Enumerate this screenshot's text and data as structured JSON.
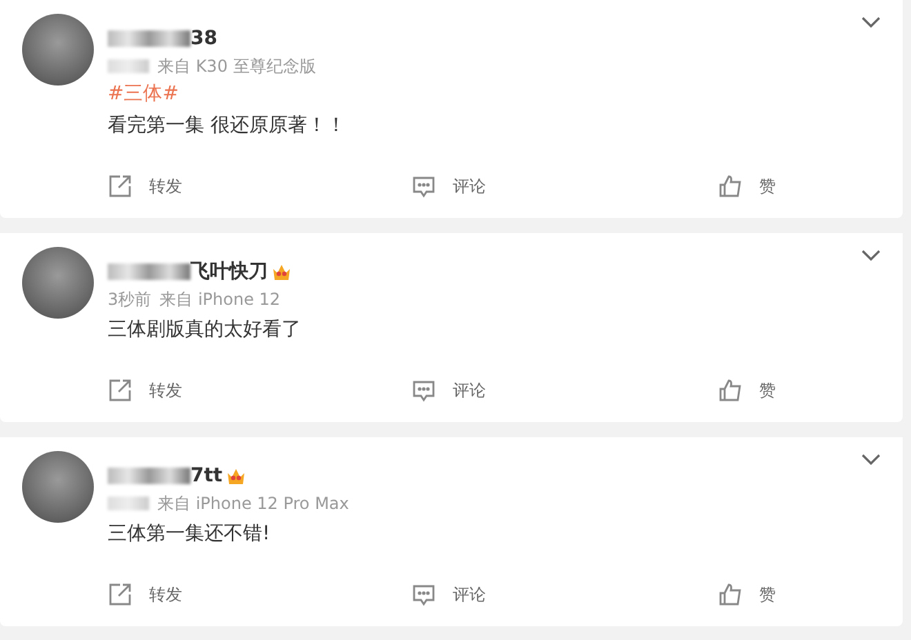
{
  "posts": [
    {
      "name": "38",
      "vip": false,
      "source": "来自 K30 至尊纪念版",
      "topic": "#三体#",
      "text": "看完第一集 很还原原著！！",
      "actions": [
        "转发",
        "评论",
        "赞"
      ]
    },
    {
      "name": "飞叶快刀",
      "vip": true,
      "time": "3秒前",
      "source": "来自 iPhone 12",
      "text": "三体剧版真的太好看了",
      "actions": [
        "转发",
        "评论",
        "赞"
      ]
    },
    {
      "name": "7tt",
      "vip": true,
      "source": "来自 iPhone 12 Pro Max",
      "text": "三体第一集还不错!",
      "actions": [
        "转发",
        "评论",
        "赞"
      ]
    }
  ]
}
